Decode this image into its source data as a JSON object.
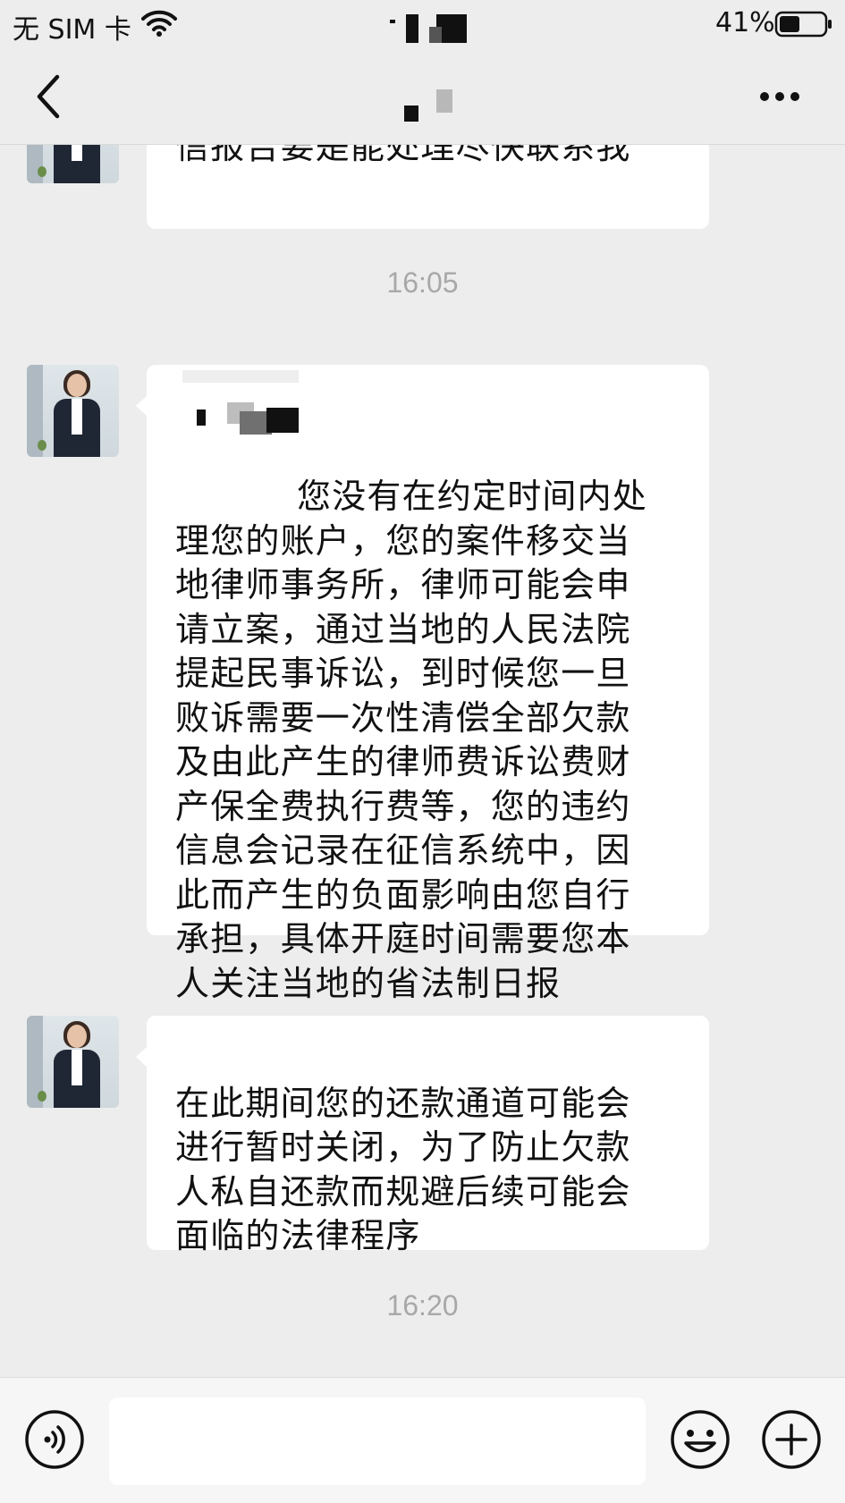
{
  "status_bar": {
    "carrier": "无 SIM 卡",
    "battery_percent": "41%"
  },
  "icons": {
    "wifi": "wifi-icon",
    "battery": "battery-icon",
    "back": "chevron-left-icon",
    "more": "more-dots-icon",
    "voice": "voice-icon",
    "emoji": "emoji-icon",
    "plus": "plus-icon"
  },
  "chat": {
    "messages": [
      {
        "sender": "contact",
        "partial_text": "信报告要是能处理尽快联系我"
      },
      {
        "type": "time",
        "text": "16:05"
      },
      {
        "sender": "contact",
        "text": "您没有在约定时间内处\n理您的账户，您的案件移交当\n地律师事务所，律师可能会申\n请立案，通过当地的人民法院\n提起民事诉讼，到时候您一旦\n败诉需要一次性清偿全部欠款\n及由此产生的律师费诉讼费财\n产保全费执行费等，您的违约\n信息会记录在征信系统中，因\n此而产生的负面影响由您自行\n承担，具体开庭时间需要您本\n人关注当地的省法制日报"
      },
      {
        "sender": "contact",
        "text": "在此期间您的还款通道可能会\n进行暂时关闭，为了防止欠款\n人私自还款而规避后续可能会\n面临的法律程序"
      },
      {
        "type": "time",
        "text": "16:20"
      }
    ]
  },
  "input": {
    "value": "",
    "placeholder": ""
  }
}
